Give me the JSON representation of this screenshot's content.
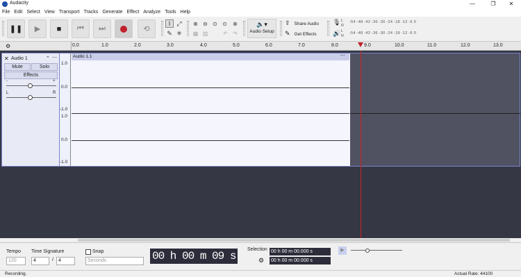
{
  "app": {
    "title": "Audacity"
  },
  "window_buttons": {
    "minimize": "—",
    "maximize": "❐",
    "close": "✕"
  },
  "menu": [
    "File",
    "Edit",
    "Select",
    "View",
    "Transport",
    "Tracks",
    "Generate",
    "Effect",
    "Analyze",
    "Tools",
    "Help"
  ],
  "toolbar": {
    "audio_setup": "Audio Setup",
    "share_audio": "Share Audio",
    "get_effects": "Get Effects",
    "meter_scale": "-54 -48 -42 -36 -30 -24 -18 -12 -6  0",
    "meter_scale_bottom": "-54 -48 -42 -36 -30 -24 -18 -12 -6  0",
    "meter_l": "L",
    "meter_r": "R"
  },
  "ruler": {
    "ticks": [
      "0.0",
      "1.0",
      "2.0",
      "3.0",
      "4.0",
      "5.0",
      "6.0",
      "7.0",
      "8.0",
      "9.0",
      "10.0",
      "11.0",
      "12.0",
      "13.0"
    ]
  },
  "track": {
    "name": "Audio 1",
    "mute": "Mute",
    "solo": "Solo",
    "effects": "Effects",
    "gain_minus": "-",
    "gain_plus": "+",
    "pan_l": "L",
    "pan_r": "R",
    "clip_name": "Audio 1.1",
    "scale_top": [
      "1.0",
      "0.0",
      "-1.0"
    ],
    "scale_bottom": [
      "1.0",
      "0.0",
      "-1.0"
    ]
  },
  "bottom": {
    "tempo_label": "Tempo",
    "tempo_value": "120",
    "timesig_label": "Time Signature",
    "timesig_num": "4",
    "timesig_sep": "/",
    "timesig_den": "4",
    "snap_label": "Snap",
    "snap_mode": "Seconds",
    "time_display": "00 h 00 m 09 s",
    "selection_label": "Selection",
    "sel_start": "00 h 00 m 00.000 s",
    "sel_end": "00 h 00 m 00.000 s"
  },
  "status": {
    "left": "Recording.",
    "right": "Actual Rate: 44100"
  },
  "colors": {
    "accent": "#7a84c8",
    "record": "#c0212b",
    "playhead": "#cc2222",
    "track_bg": "#353745"
  }
}
